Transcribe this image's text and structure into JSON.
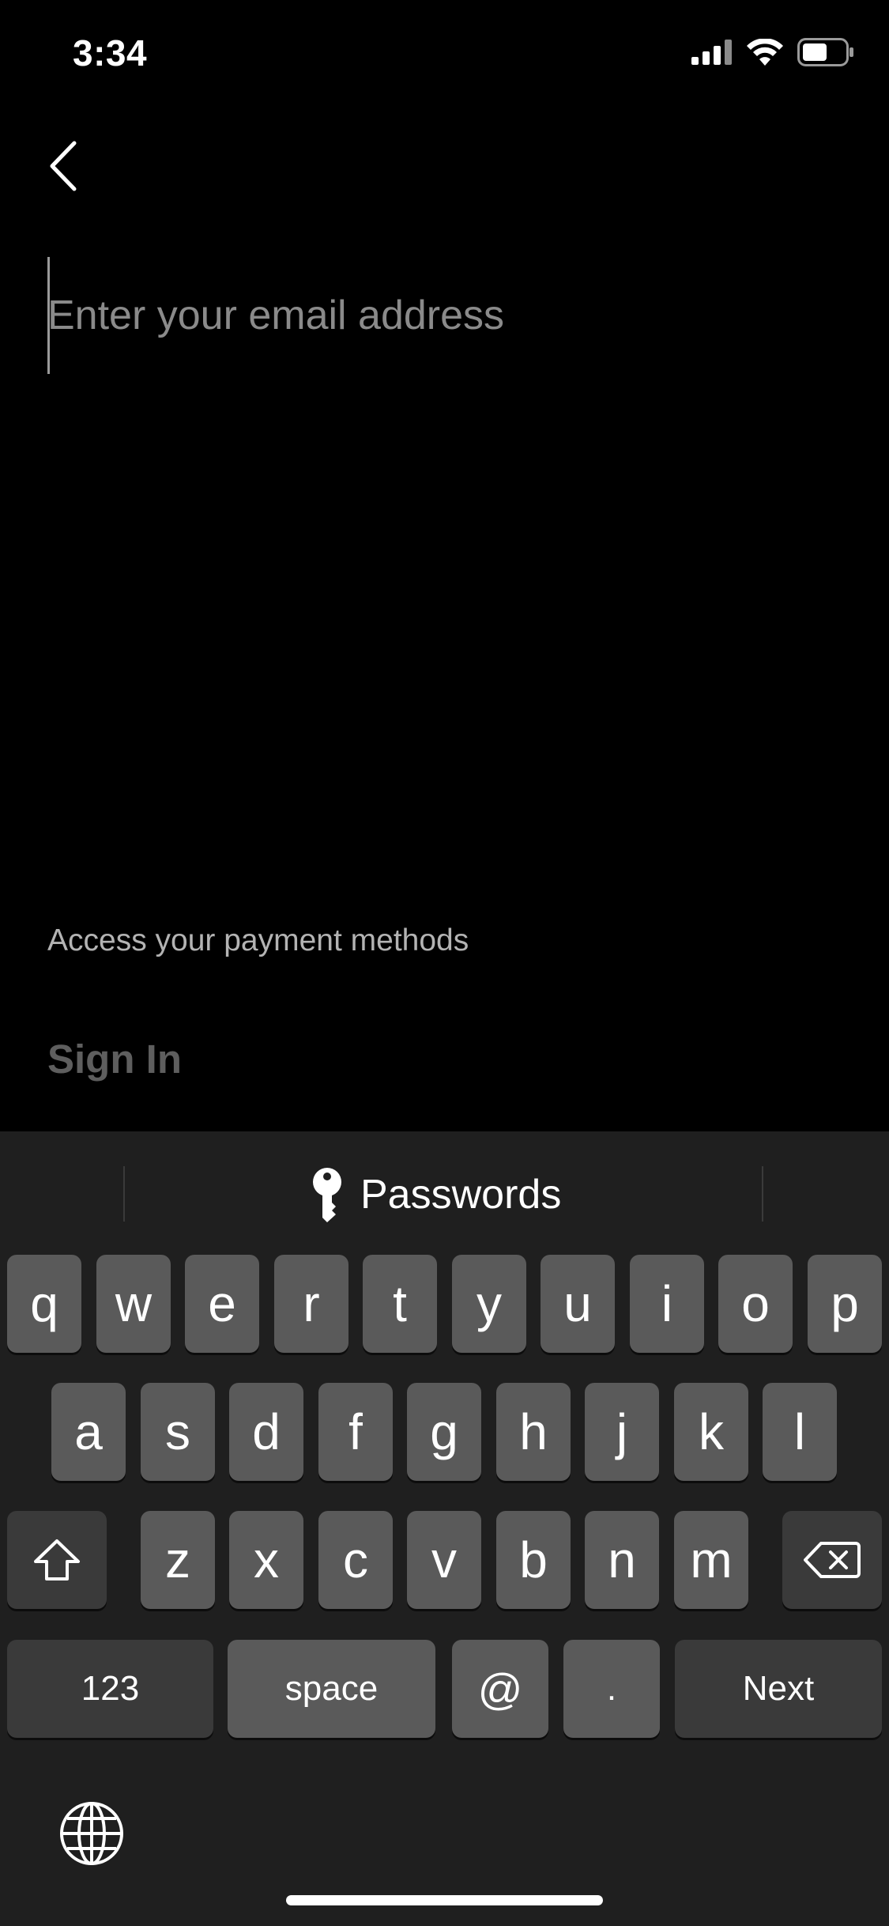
{
  "status_bar": {
    "time": "3:34"
  },
  "email": {
    "placeholder": "Enter your email address",
    "value": ""
  },
  "helper_text": "Access your payment methods",
  "signin_label": "Sign In",
  "keyboard": {
    "passwords_label": "Passwords",
    "row1": [
      "q",
      "w",
      "e",
      "r",
      "t",
      "y",
      "u",
      "i",
      "o",
      "p"
    ],
    "row2": [
      "a",
      "s",
      "d",
      "f",
      "g",
      "h",
      "j",
      "k",
      "l"
    ],
    "row3": [
      "z",
      "x",
      "c",
      "v",
      "b",
      "n",
      "m"
    ],
    "row4": {
      "numbers": "123",
      "space": "space",
      "at": "@",
      "dot": ".",
      "next": "Next"
    }
  },
  "icons": {
    "back": "chevron-left-icon",
    "signal": "cellular-signal-icon",
    "wifi": "wifi-icon",
    "battery": "battery-icon",
    "key": "key-icon",
    "shift": "shift-icon",
    "delete": "backspace-icon",
    "globe": "globe-icon"
  },
  "colors": {
    "background": "#000000",
    "keyboard_bg": "#1f1f1f",
    "key": "#5a5a5a",
    "key_dark": "#3a3a3a",
    "signin_disabled": "#5e5e5e"
  }
}
